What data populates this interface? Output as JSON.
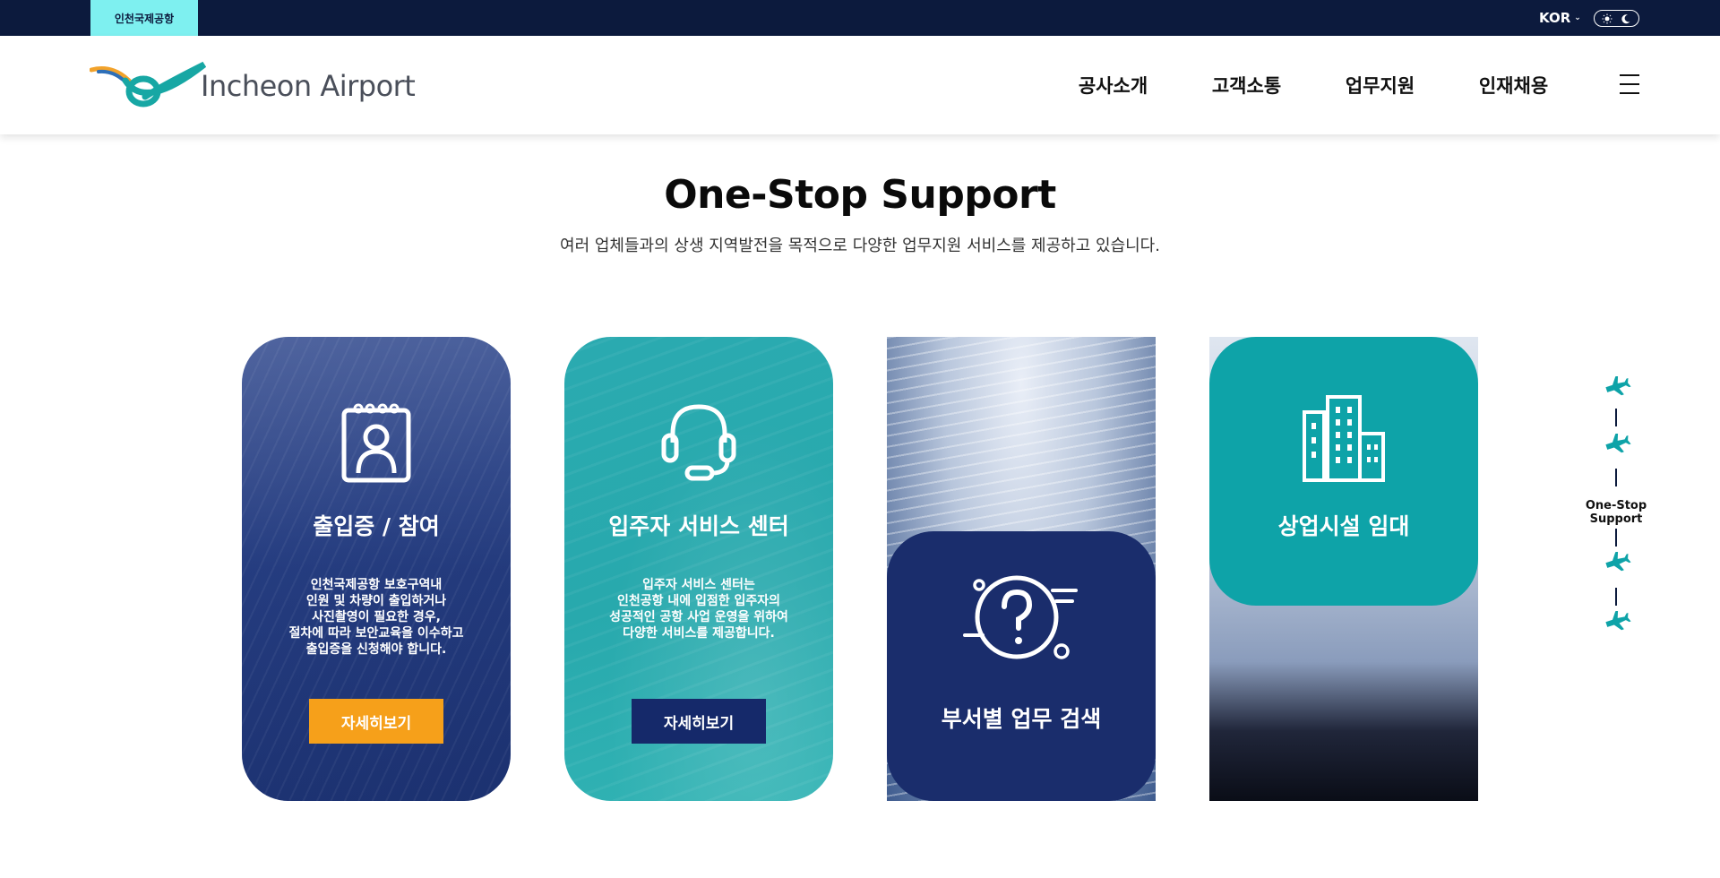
{
  "topbar": {
    "site_tab": "인천국제공항",
    "language": "KOR"
  },
  "header": {
    "logo_text": "Incheon Airport",
    "nav": [
      "공사소개",
      "고객소통",
      "업무지원",
      "인재채용"
    ]
  },
  "section": {
    "title": "One-Stop Support",
    "subtitle": "여러 업체들과의 상생 지역발전을 목적으로 다양한 업무지원 서비스를 제공하고 있습니다."
  },
  "cards": [
    {
      "title": "출입증 / 참여",
      "desc": [
        "인천국제공항 보호구역내",
        "인원 및 차량이 출입하거나",
        "사진촬영이 필요한 경우,",
        "절차에 따라 보안교육을 이수하고",
        "출입증을 신청해야 합니다."
      ],
      "button": "자세히보기",
      "icon": "id-badge-icon"
    },
    {
      "title": "입주자 서비스 센터",
      "desc": [
        "입주자 서비스 센터는",
        "인천공항 내에 입점한 입주자의",
        "성공적인 공항 사업 운영을 위하여",
        "다양한 서비스를 제공합니다."
      ],
      "button": "자세히보기",
      "icon": "headset-icon"
    },
    {
      "title": "부서별 업무 검색",
      "icon": "question-search-icon"
    },
    {
      "title": "상업시설 임대",
      "icon": "buildings-icon"
    }
  ],
  "side_indicator": {
    "label": "One-Stop Support",
    "icon": "airplane-icon"
  },
  "colors": {
    "topbar": "#0c1a3d",
    "site_tab": "#7ef0f0",
    "card_navy": "#263e82",
    "card_teal": "#28a9ad",
    "button_orange": "#f6a01a",
    "button_navy": "#15296a",
    "accent_teal": "#0ea3a8"
  }
}
